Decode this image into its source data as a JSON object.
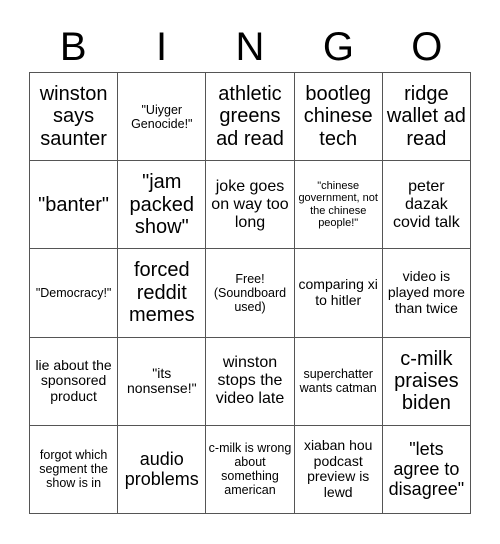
{
  "header": {
    "letters": [
      "B",
      "I",
      "N",
      "G",
      "O"
    ]
  },
  "board": {
    "rows": [
      [
        "winston says saunter",
        "\"Uiyger Genocide!\"",
        "athletic greens ad read",
        "bootleg chinese tech",
        "ridge wallet ad read"
      ],
      [
        "\"banter\"",
        "\"jam packed show\"",
        "joke goes on way too long",
        "\"chinese government, not the chinese people!\"",
        "peter dazak covid talk"
      ],
      [
        "\"Democracy!\"",
        "forced reddit memes",
        "Free! (Soundboard used)",
        "comparing xi to hitler",
        "video is played more than twice"
      ],
      [
        "lie about the sponsored product",
        "\"its nonsense!\"",
        "winston stops the video late",
        "superchatter wants catman",
        "c-milk praises biden"
      ],
      [
        "forgot which segment the show is in",
        "audio problems",
        "c-milk is wrong about something american",
        "xiaban hou podcast preview is lewd",
        "\"lets agree to disagree\""
      ]
    ]
  }
}
